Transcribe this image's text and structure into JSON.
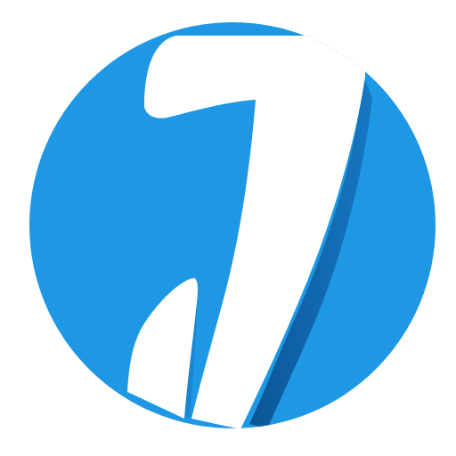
{
  "app_icon": {
    "name": "app-logo",
    "glyph": "1",
    "colors": {
      "background": "#ffffff",
      "disc": "#1e98e4",
      "disc_shadow": "#1778c2",
      "glyph": "#ffffff",
      "glyph_edge": "#0d5ea7"
    }
  }
}
